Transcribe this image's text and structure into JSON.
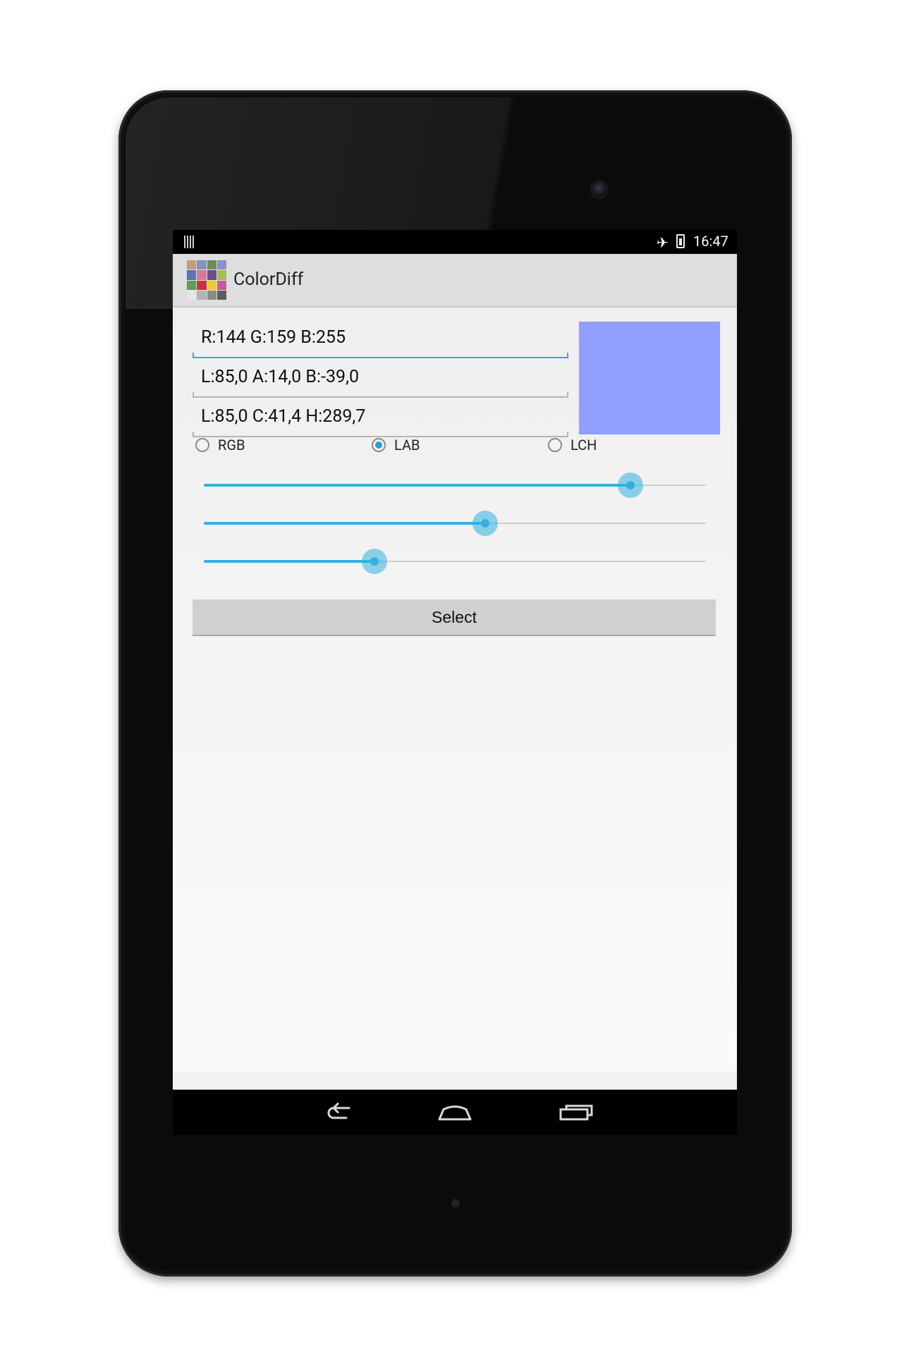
{
  "status_bar": {
    "time": "16:47"
  },
  "app": {
    "title": "ColorDiff"
  },
  "fields": {
    "rgb": "R:144 G:159 B:255",
    "lab": "L:85,0 A:14,0 B:-39,0",
    "lch": "L:85,0 C:41,4 H:289,7"
  },
  "swatch_color": "#909fff",
  "radios": [
    {
      "label": "RGB",
      "checked": false
    },
    {
      "label": "LAB",
      "checked": true
    },
    {
      "label": "LCH",
      "checked": false
    }
  ],
  "sliders": [
    0.85,
    0.56,
    0.34
  ],
  "accent_color": "#33b0e0",
  "button": {
    "label": "Select"
  },
  "nav": {
    "icons": [
      "back-icon",
      "home-icon",
      "recents-icon"
    ]
  }
}
